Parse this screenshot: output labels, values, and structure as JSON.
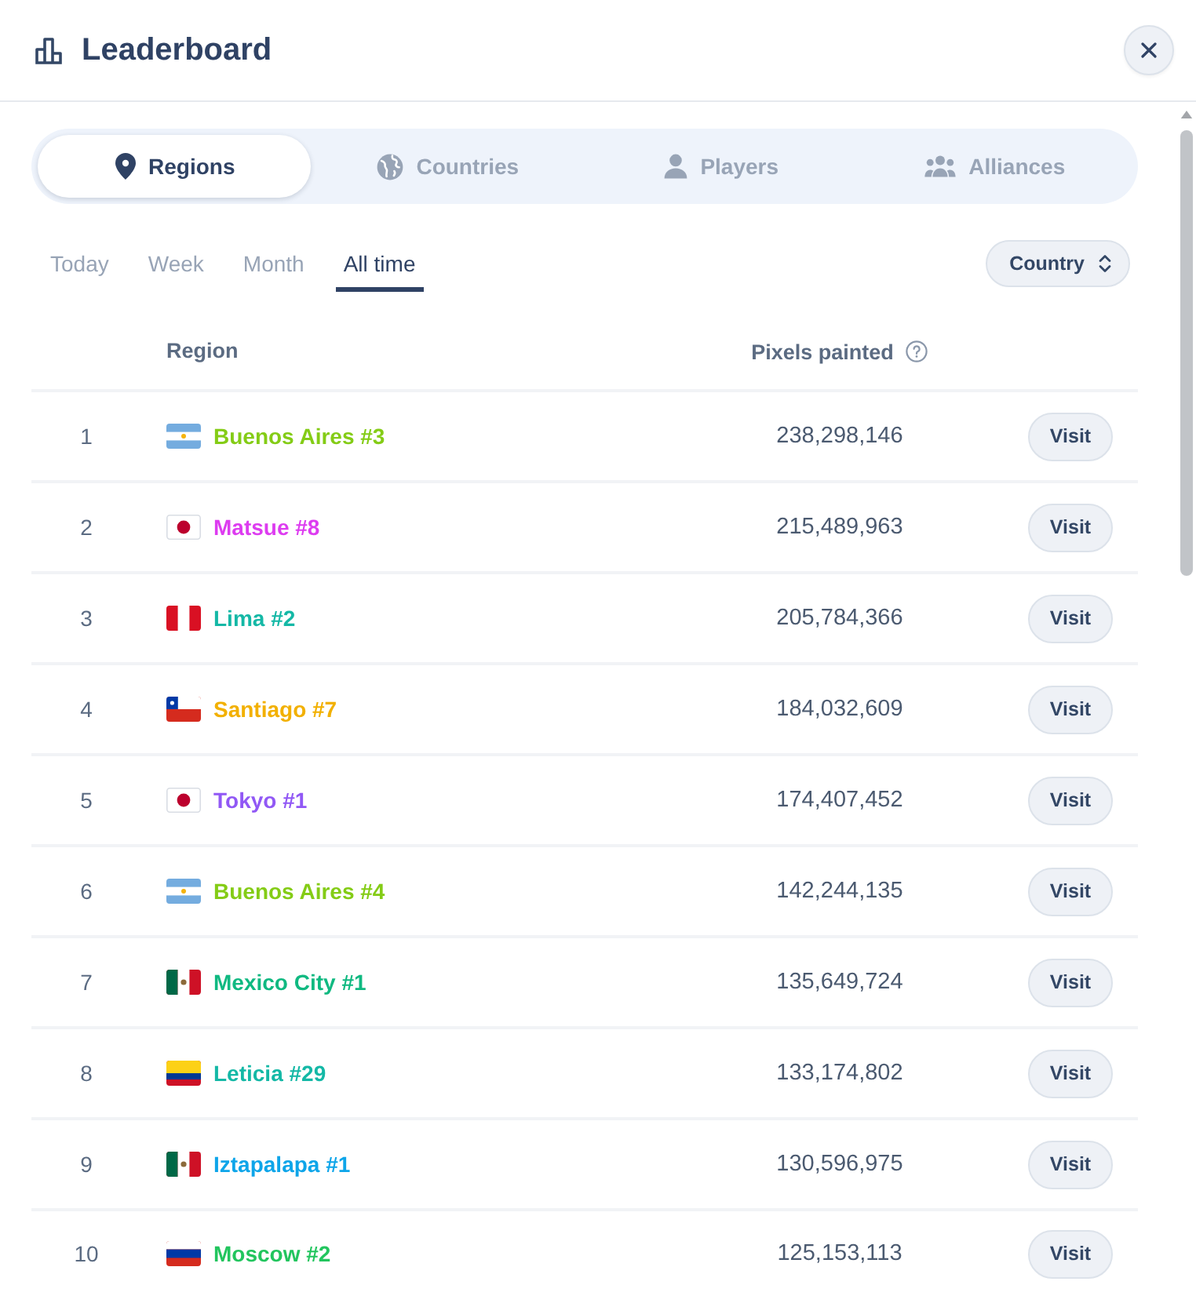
{
  "window": {
    "title": "Leaderboard"
  },
  "category_tabs": [
    {
      "label": "Regions",
      "kind": "pin",
      "selected": true
    },
    {
      "label": "Countries",
      "kind": "globe",
      "selected": false
    },
    {
      "label": "Players",
      "kind": "person",
      "selected": false
    },
    {
      "label": "Alliances",
      "kind": "group",
      "selected": false
    }
  ],
  "periods": [
    {
      "label": "Today",
      "selected": false
    },
    {
      "label": "Week",
      "selected": false
    },
    {
      "label": "Month",
      "selected": false
    },
    {
      "label": "All time",
      "selected": true
    }
  ],
  "filter": {
    "label": "Country"
  },
  "table": {
    "columns": [
      "Region",
      "Pixels painted"
    ],
    "rows": [
      {
        "rank": "1",
        "kind": "argentina",
        "name": "Buenos Aires #3",
        "color": "#84cc16",
        "pixels": "238,298,146",
        "action": "Visit"
      },
      {
        "rank": "2",
        "kind": "japan",
        "name": "Matsue #8",
        "color": "#dd3cf0",
        "pixels": "215,489,963",
        "action": "Visit"
      },
      {
        "rank": "3",
        "kind": "peru",
        "name": "Lima #2",
        "color": "#14b8a6",
        "pixels": "205,784,366",
        "action": "Visit"
      },
      {
        "rank": "4",
        "kind": "chile",
        "name": "Santiago #7",
        "color": "#f2b000",
        "pixels": "184,032,609",
        "action": "Visit"
      },
      {
        "rank": "5",
        "kind": "japan",
        "name": "Tokyo #1",
        "color": "#9158f5",
        "pixels": "174,407,452",
        "action": "Visit"
      },
      {
        "rank": "6",
        "kind": "argentina",
        "name": "Buenos Aires #4",
        "color": "#84cc16",
        "pixels": "142,244,135",
        "action": "Visit"
      },
      {
        "rank": "7",
        "kind": "mexico",
        "name": "Mexico City #1",
        "color": "#10b981",
        "pixels": "135,649,724",
        "action": "Visit"
      },
      {
        "rank": "8",
        "kind": "colombia",
        "name": "Leticia #29",
        "color": "#14b8a6",
        "pixels": "133,174,802",
        "action": "Visit"
      },
      {
        "rank": "9",
        "kind": "mexico",
        "name": "Iztapalapa #1",
        "color": "#0ea5e9",
        "pixels": "130,596,975",
        "action": "Visit"
      },
      {
        "rank": "10",
        "kind": "russia",
        "name": "Moscow #2",
        "color": "#22c55e",
        "pixels": "125,153,113",
        "action": "Visit"
      }
    ]
  }
}
